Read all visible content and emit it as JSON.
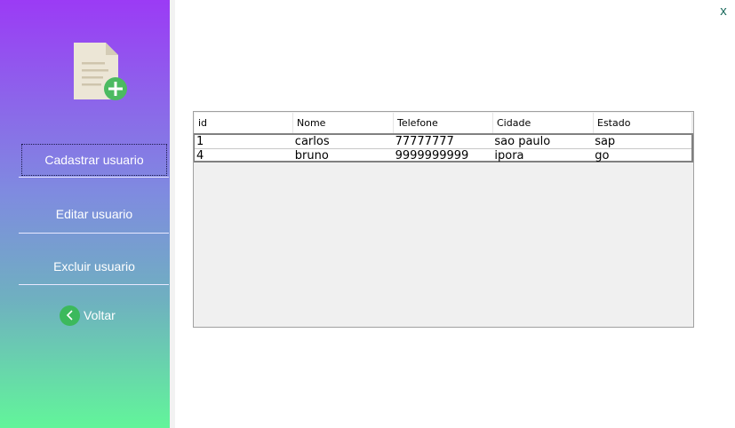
{
  "window": {
    "close_label": "x"
  },
  "sidebar": {
    "icon": "document-add-icon",
    "buttons": {
      "cadastrar": "Cadastrar usuario",
      "editar": "Editar usuario",
      "excluir": "Excluir usuario",
      "voltar": "Voltar"
    },
    "colors": {
      "gradient_top": "#9b3bf5",
      "gradient_bottom": "#62f59a",
      "accent_green": "#3cb95c"
    }
  },
  "table": {
    "columns": [
      "id",
      "Nome",
      "Telefone",
      "Cidade",
      "Estado"
    ],
    "rows": [
      [
        "1",
        "carlos",
        "77777777",
        "sao paulo",
        "sap"
      ],
      [
        "4",
        "bruno",
        "9999999999",
        "ipora",
        "go"
      ]
    ]
  }
}
